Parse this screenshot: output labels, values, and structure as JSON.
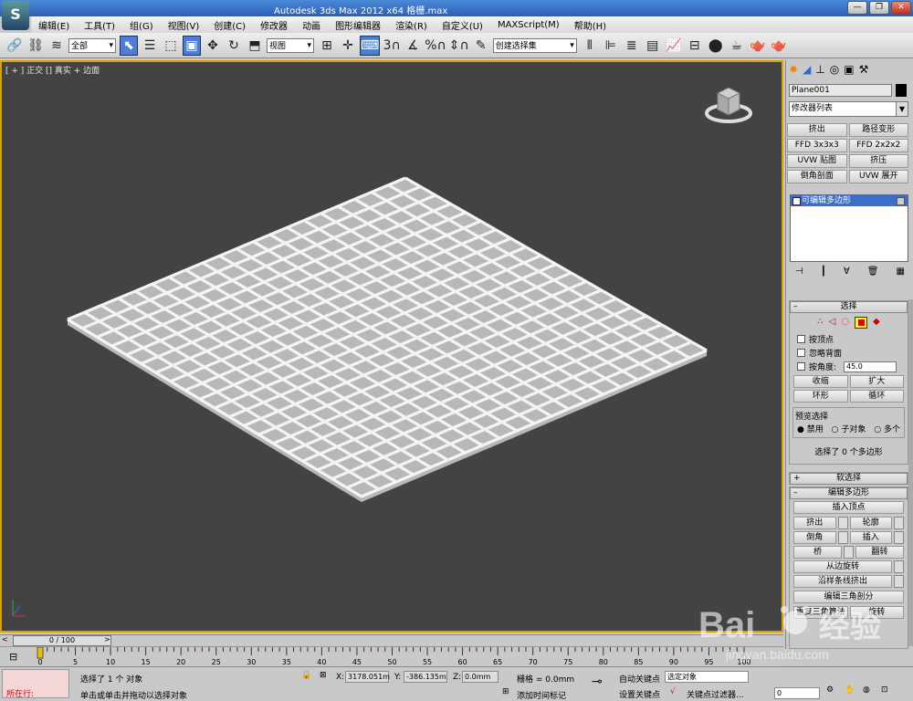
{
  "titlebar": {
    "title": "Autodesk 3ds Max  2012 x64      格栅.max"
  },
  "menus": [
    "编辑(E)",
    "工具(T)",
    "组(G)",
    "视图(V)",
    "创建(C)",
    "修改器",
    "动画",
    "图形编辑器",
    "渲染(R)",
    "自定义(U)",
    "MAXScript(M)",
    "帮助(H)"
  ],
  "toolbar": {
    "selection_filter": "全部",
    "ref_coord": "视图",
    "named_selection": "创建选择集"
  },
  "viewport": {
    "label": "[ + ] 正交 [] 真实 + 边面"
  },
  "command_panel": {
    "object_name": "Plane001",
    "object_color": "#000000",
    "modifier_list": "修改器列表",
    "modifier_buttons": [
      "挤出",
      "路径变形",
      "FFD 3x3x3",
      "FFD 2x2x2",
      "UVW 贴图",
      "挤压",
      "倒角剖面",
      "UVW 展开"
    ],
    "stack_item": "可编辑多边形",
    "selection": {
      "title": "选择",
      "by_vertex": "按顶点",
      "ignore_backfacing": "忽略背面",
      "by_angle": "按角度:",
      "angle_value": "45.0",
      "shrink": "收缩",
      "grow": "扩大",
      "ring": "环形",
      "loop": "循环",
      "preview_title": "预览选择",
      "preview_disabled": "禁用",
      "preview_subobject": "子对象",
      "preview_multi": "多个",
      "status": "选择了 0 个多边形"
    },
    "soft_selection": "软选择",
    "edit_polygons": {
      "title": "编辑多边形",
      "insert_vertex": "插入顶点",
      "extrude": "挤出",
      "outline": "轮廓",
      "bevel": "倒角",
      "inset": "插入",
      "bridge": "桥",
      "flip": "翻转",
      "hinge": "从边旋转",
      "extrude_spline": "沿样条线挤出",
      "edit_triangulation": "编辑三角剖分",
      "retriangulate": "重复三角算法",
      "turn": "旋转"
    }
  },
  "timeline": {
    "frame": "0 / 100",
    "prev": "<",
    "next": ">"
  },
  "ruler_ticks": [
    "0",
    "5",
    "10",
    "15",
    "20",
    "25",
    "30",
    "35",
    "40",
    "45",
    "50",
    "55",
    "60",
    "65",
    "70",
    "75",
    "80",
    "85",
    "90",
    "95",
    "100"
  ],
  "status": {
    "maxscript_prompt": "所在行:",
    "selected": "选择了 1 个 对象",
    "prompt": "单击或单击并拖动以选择对象",
    "x_label": "X:",
    "x_value": "3178.051m",
    "y_label": "Y:",
    "y_value": "-386.135m",
    "z_label": "Z:",
    "z_value": "0.0mm",
    "grid": "栅格 = 0.0mm",
    "add_time_tag": "添加时间标记",
    "auto_key": "自动关键点",
    "set_key": "设置关键点",
    "selected_object": "选定对象",
    "key_filters": "关键点过滤器...",
    "frame_field": "0"
  },
  "watermark": {
    "brand_latin": "Bai",
    "brand_cn": "经验",
    "url": "jingyan.baidu.com"
  }
}
